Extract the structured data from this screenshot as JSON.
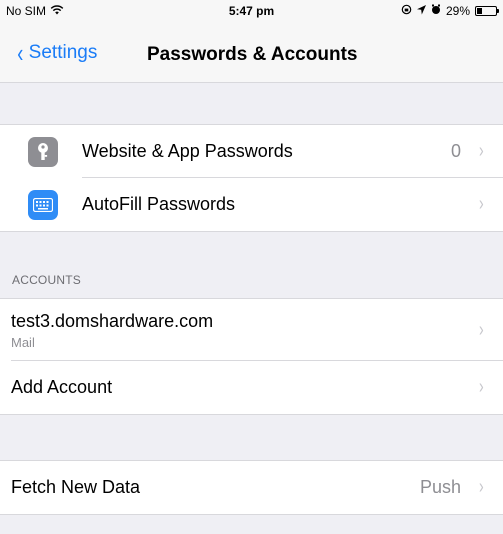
{
  "status_bar": {
    "carrier": "No SIM",
    "time": "5:47 pm",
    "battery_percent": "29%",
    "icons": [
      "wifi-icon",
      "lock-rotation-icon",
      "location-icon",
      "alarm-icon",
      "battery-icon"
    ]
  },
  "nav": {
    "back_label": "Settings",
    "title": "Passwords & Accounts"
  },
  "passwords_group": {
    "items": [
      {
        "label": "Website & App Passwords",
        "value": "0",
        "icon": "key-icon"
      },
      {
        "label": "AutoFill Passwords",
        "value": "",
        "icon": "keyboard-icon"
      }
    ]
  },
  "accounts_group": {
    "header": "ACCOUNTS",
    "items": [
      {
        "label": "test3.domshardware.com",
        "sublabel": "Mail"
      },
      {
        "label": "Add Account"
      }
    ]
  },
  "fetch_group": {
    "items": [
      {
        "label": "Fetch New Data",
        "value": "Push"
      }
    ]
  },
  "colors": {
    "accent": "#1a7cf7",
    "background": "#efeff4",
    "separator": "#d8d8dc",
    "secondary_text": "#8e8e93"
  }
}
